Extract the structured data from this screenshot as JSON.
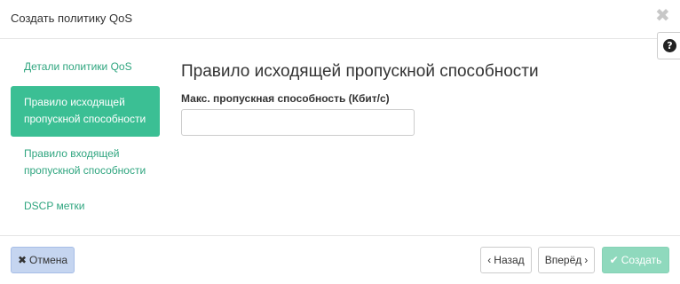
{
  "modal": {
    "title": "Создать политику QoS",
    "close_symbol": "✖",
    "help_symbol": "?"
  },
  "nav": {
    "items": [
      {
        "line1": "Детали политики QoS",
        "line2": ""
      },
      {
        "line1": "Правило исходящей",
        "line2": "пропускной способности"
      },
      {
        "line1": "Правило входящей",
        "line2": "пропускной способности"
      },
      {
        "line1": "DSCP метки",
        "line2": ""
      }
    ],
    "active_index": 1
  },
  "main": {
    "section_title": "Правило исходящей пропускной способности",
    "max_bandwidth_label": "Макс. пропускная способность (Кбит/с)",
    "max_bandwidth_value": ""
  },
  "footer": {
    "cancel_label": "Отмена",
    "cancel_icon": "times-icon",
    "back_label": "Назад",
    "back_icon": "chevron-left-icon",
    "next_label": "Вперёд",
    "next_icon": "chevron-right-icon",
    "create_label": "Создать",
    "create_icon": "check-icon"
  },
  "colors": {
    "accent": "#3bbf94",
    "nav_link": "#2fa57f",
    "cancel_bg": "#c5d5f0",
    "create_bg_disabled": "#8fd9bd"
  }
}
